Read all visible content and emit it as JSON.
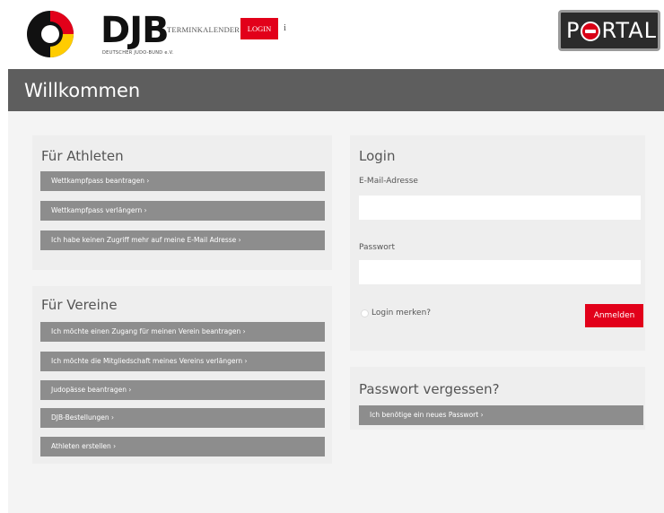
{
  "header": {
    "logo_text": "DJB",
    "logo_subtitle": "DEUTSCHER JUDO-BUND e.V.",
    "nav": {
      "terminkalender": "TERMINKALENDER",
      "login": "LOGIN",
      "info": "i"
    },
    "portal_before": "P",
    "portal_after": "RTAL"
  },
  "page_title": "Willkommen",
  "athleten": {
    "title": "Für Athleten",
    "buttons": [
      "Wettkampfpass beantragen  ›",
      "Wettkampfpass verlängern  ›",
      "Ich habe keinen Zugriff mehr auf meine E-Mail Adresse  ›"
    ]
  },
  "vereine": {
    "title": "Für Vereine",
    "buttons": [
      "Ich möchte einen Zugang für meinen Verein beantragen  ›",
      "Ich möchte die Mitgliedschaft meines Vereins verlängern  ›",
      "Judopässe beantragen  ›",
      "DJB-Bestellungen  ›",
      "Athleten erstellen  ›"
    ]
  },
  "login": {
    "title": "Login",
    "email_label": "E-Mail-Adresse",
    "email_value": "",
    "password_label": "Passwort",
    "password_value": "",
    "remember_label": "Login merken?",
    "submit_label": "Anmelden"
  },
  "forgot": {
    "title": "Passwort vergessen?",
    "button": "Ich benötige ein neues Passwort  ›"
  },
  "colors": {
    "accent_red": "#e2001a",
    "title_bar": "#5e5e5e",
    "button_grey": "#8d8d8d"
  }
}
